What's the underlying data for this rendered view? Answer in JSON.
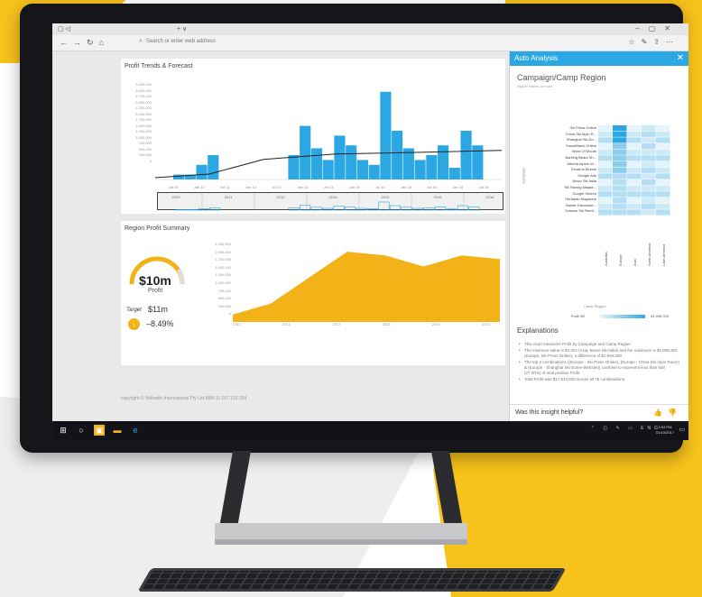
{
  "colors": {
    "accent": "#2ba8e4",
    "gold": "#f3b218",
    "background_yellow": "#f7c21b",
    "taskbar": "#111318"
  },
  "browser": {
    "address_placeholder": "Search or enter web address"
  },
  "trend_chart": {
    "title": "Profit Trends & Forecast",
    "y_ticks": [
      "3,250,000",
      "3,000,000",
      "2,750,000",
      "2,500,000",
      "2,250,000",
      "2,000,000",
      "1,750,000",
      "1,500,000",
      "1,250,000",
      "1,000,000",
      "750,000",
      "500,000",
      "250,000",
      "0"
    ],
    "x_ticks": [
      "Jul 10",
      "Jan 11",
      "Jul 11",
      "Jan 12",
      "Jul 12",
      "Jan 13",
      "Jul 13",
      "Jan 14",
      "Jul 14",
      "Jan 15",
      "Jul 15",
      "Jan 16",
      "Jul 16"
    ],
    "timeline_years": [
      "2010",
      "2011",
      "2012",
      "2013",
      "2014",
      "2015",
      "2016"
    ],
    "bar_values": [
      0.05,
      0.05,
      0.15,
      0.25,
      0,
      0,
      0,
      0,
      0,
      0,
      0.25,
      0.55,
      0.32,
      0.2,
      0.45,
      0.35,
      0.2,
      0.15,
      0.9,
      0.5,
      0.32,
      0.2,
      0.25,
      0.35,
      0.12,
      0.5,
      0.35
    ],
    "line_level": 0.28
  },
  "region_summary": {
    "title": "Region Profit Summary",
    "gauge_value": "$10m",
    "gauge_label": "Profit",
    "target_label": "Target",
    "target_value": "$11m",
    "delta_value": "–8.49%",
    "area_y_ticks": [
      "2,250,000",
      "2,000,000",
      "1,750,000",
      "1,500,000",
      "1,250,000",
      "1,000,000",
      "750,000",
      "500,000",
      "250,000",
      "0"
    ],
    "area_x_ticks": [
      "2010",
      "2011",
      "2012",
      "2013",
      "2014",
      "2015"
    ],
    "area_values": [
      0.1,
      0.25,
      0.6,
      0.95,
      0.9,
      0.75,
      0.9,
      0.85
    ]
  },
  "copyright": "copyright © Yellowfin International Pty Ltd ABN 11 107 122 334",
  "panel": {
    "header": "Auto Analysis",
    "title": "Campaign/Camp Region",
    "subtitle": "Higher values are bad",
    "y_axis_label": "Campaign",
    "rows": [
      "Ski Press Online",
      "China Ski Alpin R...",
      "Shanghai Ski Do...",
      "SnowWatch Online",
      "Word Of Mouth",
      "Barking Bears Sh...",
      "Alberta Alpine W...",
      "Email to Alumni",
      "Google Ads",
      "Bravo Ski Italia",
      "Ski Racing Magaz...",
      "Google Search",
      "SkiJapan Magazine",
      "Nanter Discounte...",
      "Schoow Ski Remf..."
    ],
    "columns": [
      "Australia",
      "Europe",
      "Asia",
      "North America",
      "Latin America"
    ],
    "x_axis_title": "Camp Region",
    "legend_label": "Profit",
    "legend_min": "$0",
    "legend_max": "$1,998,303",
    "explanations_title": "Explanations",
    "explanations": [
      "This chart measures Profit by Campaign and Camp Region",
      "The minimum value is $4,303 (Asia, Bravo Ski Italia) and the maximum is $1,998,303 (Europe, Ski Press Online), a difference of $1,994,000",
      "The top 3 combinations ((Europe - Ski Press Online), (Europe - China Ski Alpin Racer) & (Europe - Shanghai Ski Dome Website)) combine to represent less than half (27.00%) of total positive Profit",
      "Total Profit was $17,813,820 across all 75 combinations"
    ],
    "helpful_question": "Was this insight helpful?"
  },
  "taskbar": {
    "clock_time": "5:53 PM",
    "clock_date": "01/10/2017",
    "lang": "ENG"
  }
}
